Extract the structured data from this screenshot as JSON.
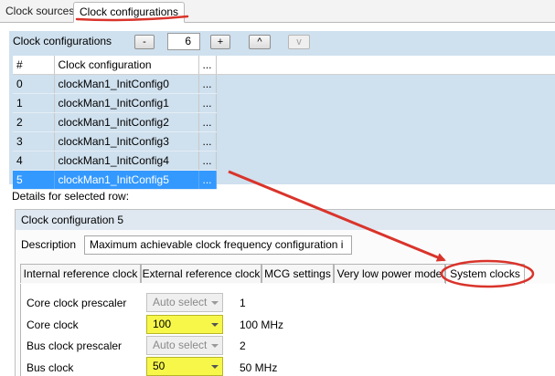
{
  "tabs": [
    "Clock sources",
    "Clock configurations"
  ],
  "config_header": {
    "label": "Clock configurations",
    "minus": "-",
    "count": "6",
    "plus": "+",
    "up": "^",
    "down": "v"
  },
  "grid": {
    "columns": [
      "#",
      "Clock configuration",
      "..."
    ],
    "rows": [
      {
        "index": "0",
        "name": "clockMan1_InitConfig0",
        "more": "..."
      },
      {
        "index": "1",
        "name": "clockMan1_InitConfig1",
        "more": "..."
      },
      {
        "index": "2",
        "name": "clockMan1_InitConfig2",
        "more": "..."
      },
      {
        "index": "3",
        "name": "clockMan1_InitConfig3",
        "more": "..."
      },
      {
        "index": "4",
        "name": "clockMan1_InitConfig4",
        "more": "..."
      },
      {
        "index": "5",
        "name": "clockMan1_InitConfig5",
        "more": "..."
      }
    ],
    "selected_index": 5
  },
  "details_label": "Details for selected row:",
  "group": {
    "title": "Clock configuration 5",
    "description_label": "Description",
    "description_value": "Maximum achievable clock frequency configuration i"
  },
  "subtabs": [
    "Internal reference clock",
    "External reference clock",
    "MCG settings",
    "Very low power mode",
    "System clocks"
  ],
  "system_clocks": [
    {
      "label": "Core clock prescaler",
      "select": "Auto select",
      "value": "1",
      "state": "disabled"
    },
    {
      "label": "Core clock",
      "select": "100",
      "value": "100 MHz",
      "state": "highlighted"
    },
    {
      "label": "Bus clock prescaler",
      "select": "Auto select",
      "value": "2",
      "state": "disabled"
    },
    {
      "label": "Bus clock",
      "select": "50",
      "value": "50 MHz",
      "state": "highlighted"
    }
  ],
  "colors": {
    "annotation_red": "#d9342b",
    "highlight_yellow": "#f7f74a",
    "selection_blue": "#3399ff",
    "panel_blue": "#cfe0ee"
  }
}
